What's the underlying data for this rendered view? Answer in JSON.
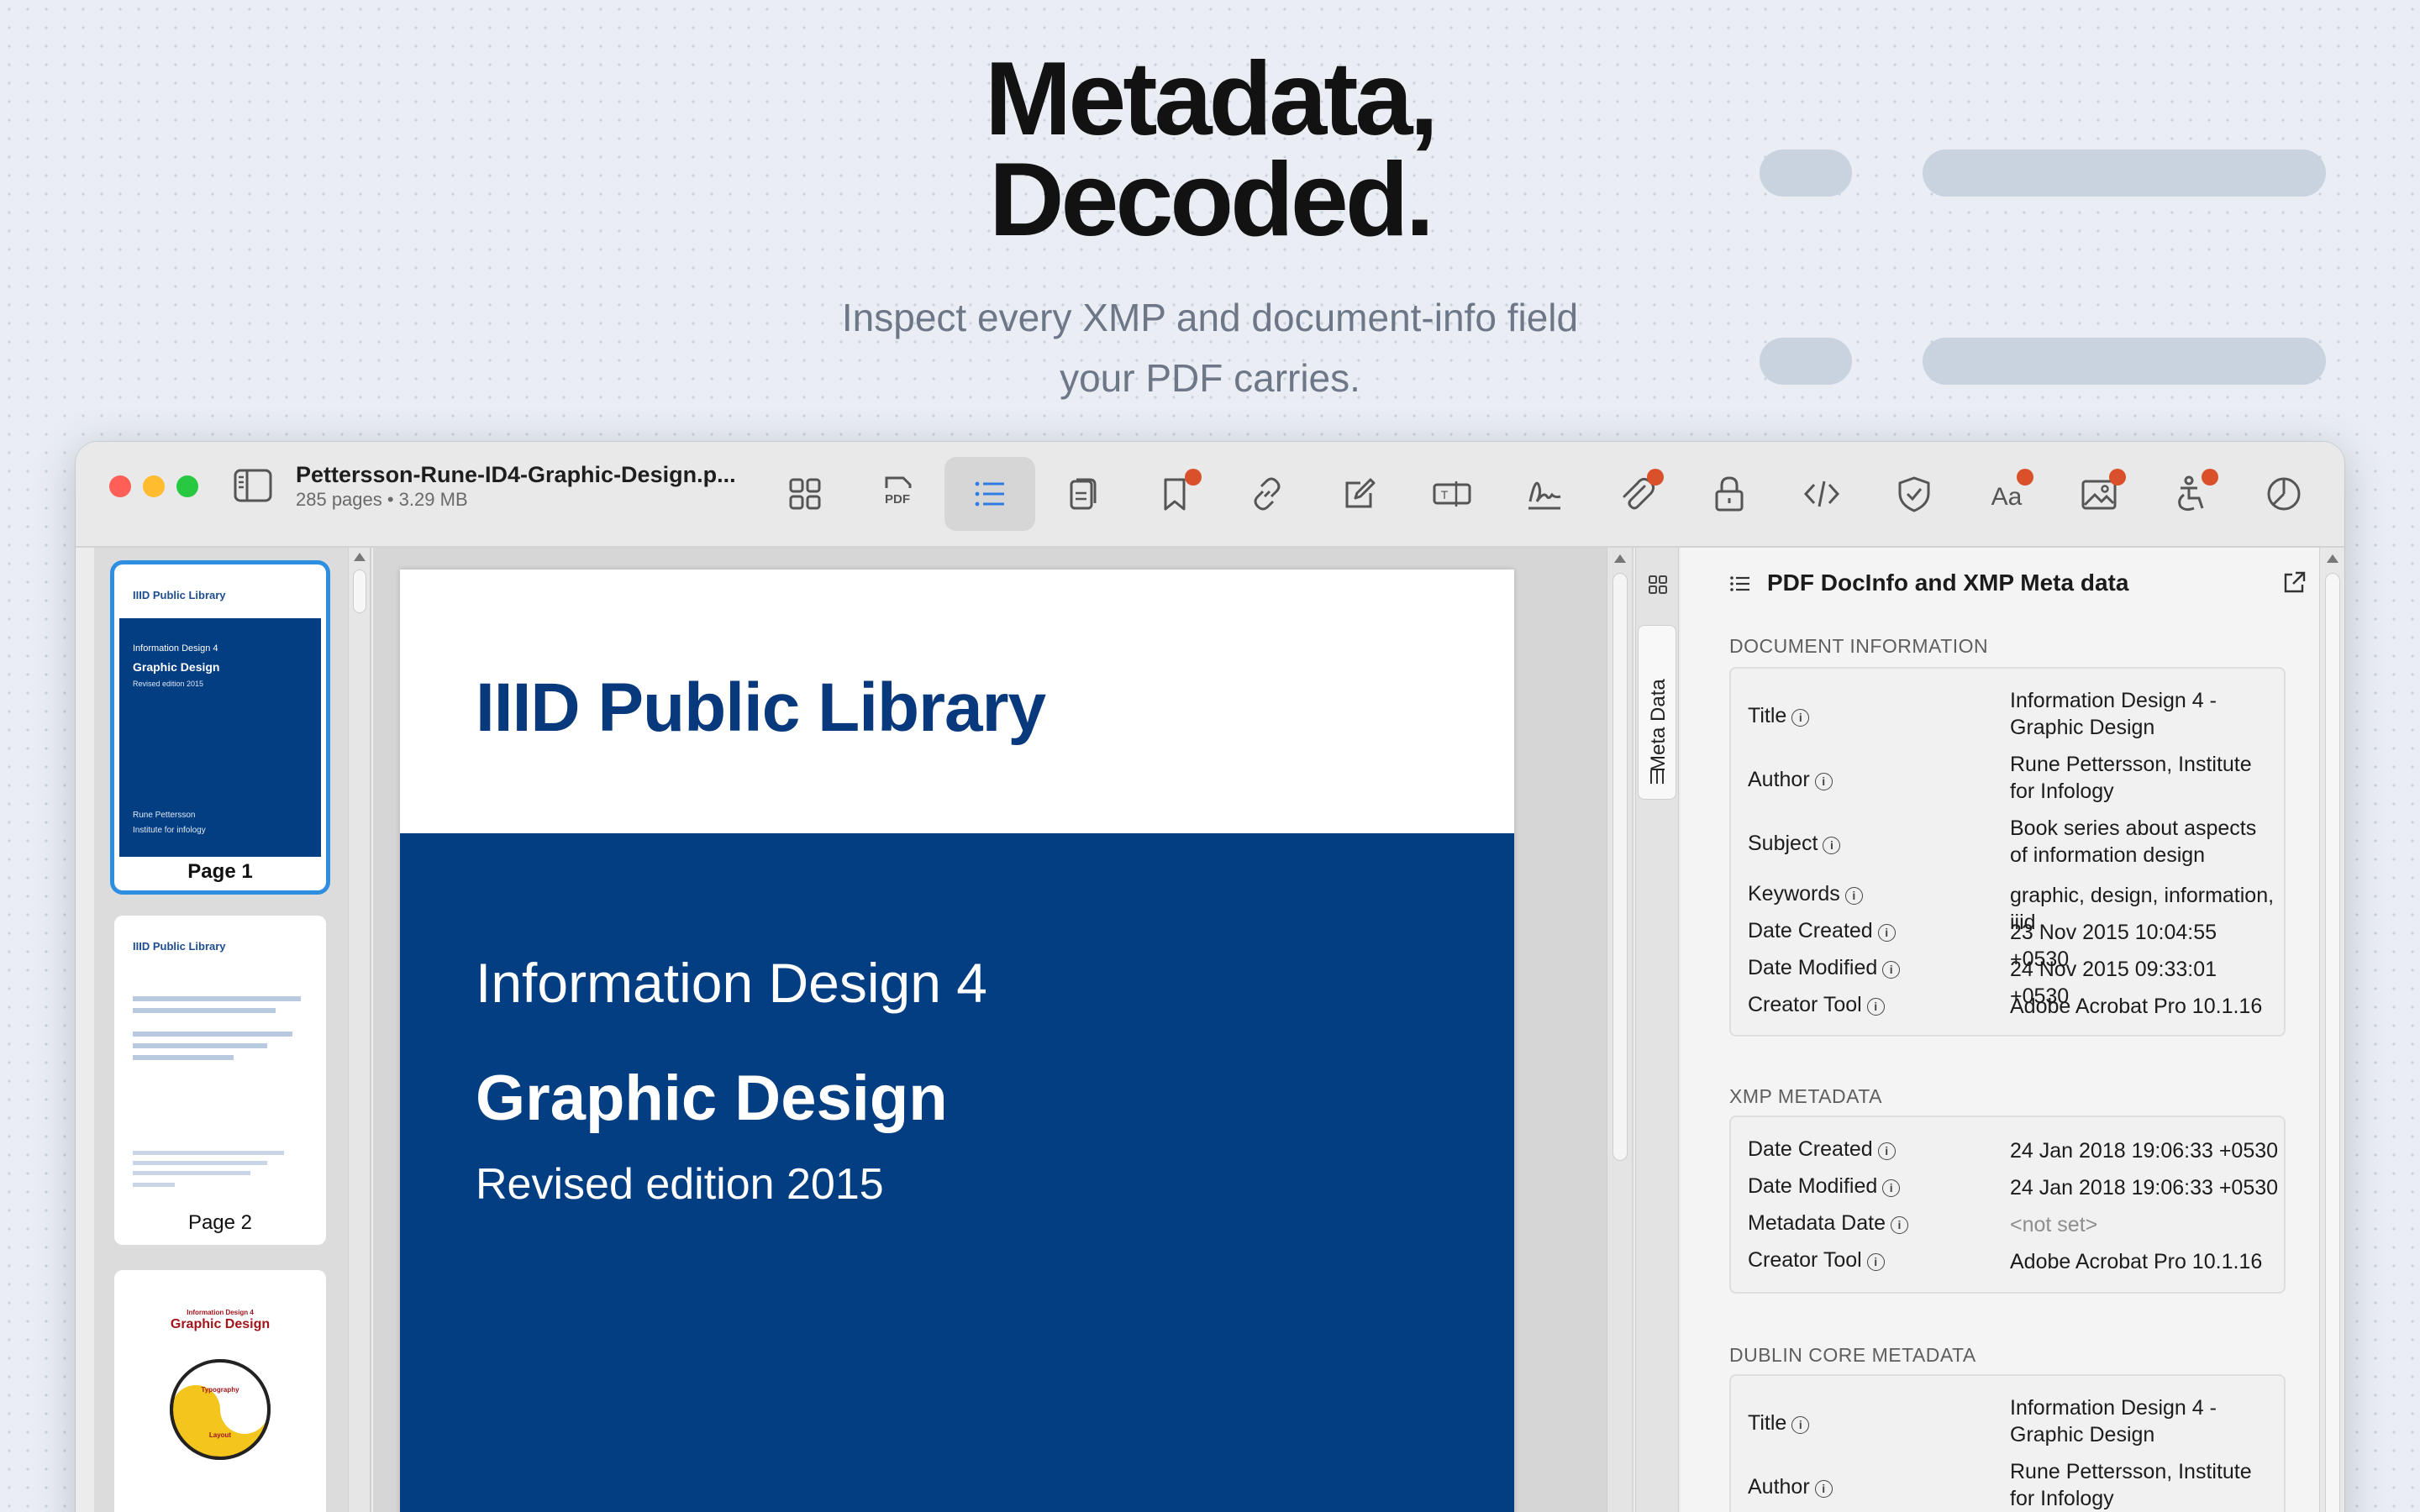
{
  "hero": {
    "title_line1": "Metadata,",
    "title_line2": "Decoded.",
    "subtitle_line1": "Inspect every XMP and document-info field",
    "subtitle_line2": "your PDF carries."
  },
  "window": {
    "document_name": "Pettersson-Rune-ID4-Graphic-Design.p...",
    "document_info": "285 pages • 3.29 MB",
    "toolbar": {
      "buttons": [
        {
          "name": "thumbnails-grid",
          "icon": "grid-icon"
        },
        {
          "name": "pdf",
          "icon": "pdf-icon",
          "label": "PDF"
        },
        {
          "name": "outline",
          "icon": "list-icon",
          "active": true
        },
        {
          "name": "pages",
          "icon": "document-icon"
        },
        {
          "name": "bookmarks",
          "icon": "bookmark-icon",
          "badge": true
        },
        {
          "name": "links",
          "icon": "link-icon"
        },
        {
          "name": "edit",
          "icon": "edit-icon"
        },
        {
          "name": "text-field",
          "icon": "text-field-icon"
        },
        {
          "name": "signature",
          "icon": "signature-icon"
        },
        {
          "name": "attachments",
          "icon": "paperclip-icon",
          "badge": true
        },
        {
          "name": "security",
          "icon": "lock-icon"
        },
        {
          "name": "code",
          "icon": "code-icon"
        },
        {
          "name": "shield",
          "icon": "shield-icon"
        },
        {
          "name": "fonts",
          "icon": "font-icon",
          "label": "Aa",
          "badge": true
        },
        {
          "name": "images",
          "icon": "image-icon",
          "badge": true
        },
        {
          "name": "accessibility",
          "icon": "accessibility-icon",
          "badge": true
        },
        {
          "name": "chart",
          "icon": "pie-chart-icon"
        }
      ]
    }
  },
  "thumbnails": [
    {
      "label": "Page 1",
      "selected": true,
      "header": "IIID Public Library",
      "l1": "Information Design 4",
      "l2": "Graphic Design",
      "l3": "Revised edition 2015",
      "l4": "Rune Pettersson",
      "l5": "Institute for infology"
    },
    {
      "label": "Page 2",
      "selected": false,
      "header": "IIID Public Library"
    },
    {
      "label": "",
      "selected": false,
      "l1": "Information Design 4",
      "l2": "Graphic Design",
      "l3": "Typography",
      "l4": "Layout"
    }
  ],
  "page": {
    "header": "IIID Public Library",
    "line1": "Information Design 4",
    "line2": "Graphic Design",
    "line3": "Revised edition 2015",
    "band_color": "#033e82",
    "header_color": "#08397c"
  },
  "side_tab": {
    "label": "Meta Data"
  },
  "panel": {
    "title": "PDF DocInfo and XMP Meta data",
    "sections": [
      {
        "title": "DOCUMENT INFORMATION",
        "rows": [
          {
            "key": "Title",
            "value": "Information Design 4 - Graphic Design"
          },
          {
            "key": "Author",
            "value": "Rune Pettersson, Institute for Infology"
          },
          {
            "key": "Subject",
            "value": "Book series about aspects of information design"
          },
          {
            "key": "Keywords",
            "value": "graphic, design, information, iiid"
          },
          {
            "key": "Date Created",
            "value": "23 Nov 2015 10:04:55 +0530"
          },
          {
            "key": "Date Modified",
            "value": "24 Nov 2015 09:33:01 +0530"
          },
          {
            "key": "Creator Tool",
            "value": "Adobe Acrobat Pro 10.1.16"
          }
        ]
      },
      {
        "title": "XMP METADATA",
        "rows": [
          {
            "key": "Date Created",
            "value": "24 Jan 2018 19:06:33 +0530"
          },
          {
            "key": "Date Modified",
            "value": "24 Jan 2018 19:06:33 +0530"
          },
          {
            "key": "Metadata Date",
            "value": "<not set>"
          },
          {
            "key": "Creator Tool",
            "value": "Adobe Acrobat Pro 10.1.16"
          }
        ]
      },
      {
        "title": "DUBLIN CORE METADATA",
        "rows": [
          {
            "key": "Title",
            "value": "Information Design 4 - Graphic Design"
          },
          {
            "key": "Author",
            "value": "Rune Pettersson, Institute for Infology"
          }
        ]
      }
    ]
  }
}
